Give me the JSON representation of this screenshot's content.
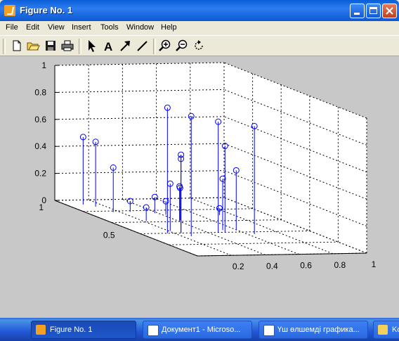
{
  "window": {
    "title": "Figure No. 1"
  },
  "menu": [
    "File",
    "Edit",
    "View",
    "Insert",
    "Tools",
    "Window",
    "Help"
  ],
  "toolbar": [
    "new-figure",
    "open",
    "save",
    "print",
    "select-arrow",
    "insert-text",
    "insert-arrow",
    "insert-line",
    "zoom-in",
    "zoom-out",
    "rotate-3d"
  ],
  "chart_data": {
    "type": "scatter",
    "subtype": "stem3",
    "axes": {
      "x_ticks": [
        "0.2",
        "0.4",
        "0.6",
        "0.8",
        "1"
      ],
      "y_ticks": [
        "0.5",
        "1"
      ],
      "z_ticks": [
        "0",
        "0.2",
        "0.4",
        "0.6",
        "0.8",
        "1"
      ],
      "xlim": [
        0,
        1
      ],
      "ylim": [
        0,
        1
      ],
      "zlim": [
        0,
        1
      ],
      "grid": true
    },
    "color": "#0000ff",
    "points": [
      {
        "x": 0.1,
        "y": 0.92,
        "z": 0.5
      },
      {
        "x": 0.14,
        "y": 0.88,
        "z": 0.48
      },
      {
        "x": 0.16,
        "y": 0.78,
        "z": 0.33
      },
      {
        "x": 0.16,
        "y": 0.4,
        "z": 0.93
      },
      {
        "x": 0.25,
        "y": 0.34,
        "z": 0.89
      },
      {
        "x": 0.24,
        "y": 0.4,
        "z": 0.58
      },
      {
        "x": 0.24,
        "y": 0.4,
        "z": 0.55
      },
      {
        "x": 0.21,
        "y": 0.44,
        "z": 0.35
      },
      {
        "x": 0.4,
        "y": 0.6,
        "z": 0.26
      },
      {
        "x": 0.42,
        "y": 0.62,
        "z": 0.24
      },
      {
        "x": 0.38,
        "y": 0.75,
        "z": 0.12
      },
      {
        "x": 0.42,
        "y": 0.72,
        "z": 0.1
      },
      {
        "x": 0.22,
        "y": 0.62,
        "z": 0.1
      },
      {
        "x": 0.26,
        "y": 0.78,
        "z": 0.08
      },
      {
        "x": 0.46,
        "y": 0.4,
        "z": 0.82
      },
      {
        "x": 0.5,
        "y": 0.4,
        "z": 0.64
      },
      {
        "x": 0.52,
        "y": 0.44,
        "z": 0.38
      },
      {
        "x": 0.64,
        "y": 0.36,
        "z": 0.8
      },
      {
        "x": 0.6,
        "y": 0.44,
        "z": 0.44
      },
      {
        "x": 0.72,
        "y": 0.7,
        "z": 0.05
      }
    ]
  },
  "taskbar": [
    {
      "label": "Figure No. 1",
      "active": true
    },
    {
      "label": "Документ1 - Microso...",
      "active": false
    },
    {
      "label": "Үш өлшемді графика...",
      "active": false
    },
    {
      "label": "Kov",
      "active": false
    }
  ],
  "colors": {
    "titlebar": "#0b58d2",
    "figure_bg": "#c8c8c8",
    "axes_bg": "#ffffff",
    "stem": "#0000ff"
  }
}
